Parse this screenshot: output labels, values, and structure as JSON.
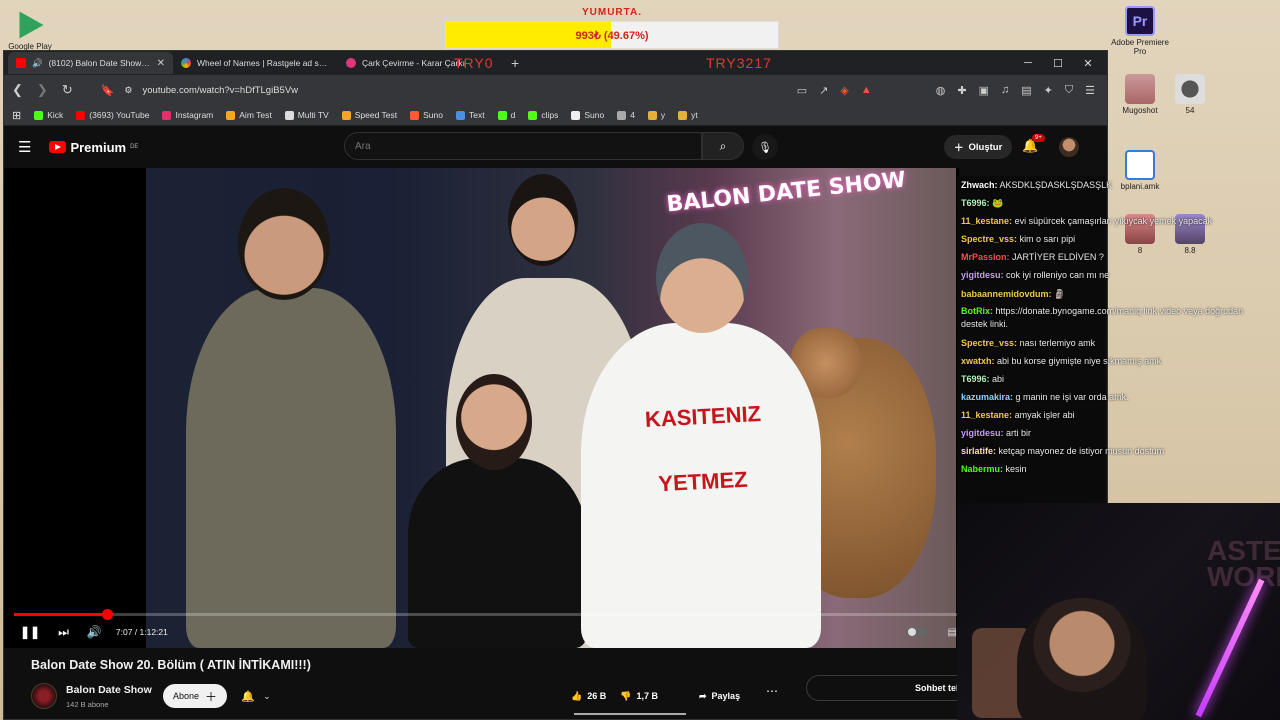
{
  "desktop": {
    "icons": [
      {
        "label": "Google Play",
        "color": "#2fa35d"
      },
      {
        "label": "Adobe Premiere Pro",
        "color": "#1d1144"
      },
      {
        "label": "Mugoshot",
        "color": "#c99"
      },
      {
        "label": "54",
        "color": "#888"
      },
      {
        "label": "bplani.amk",
        "color": "#3a7bd5"
      },
      {
        "label": "8",
        "color": "#c77"
      },
      {
        "label": "8.8",
        "color": "#86a"
      }
    ]
  },
  "donation": {
    "title": "YUMURTA.",
    "value": "993₺ (49.67%)",
    "progress_fraction": 0.4967
  },
  "browser": {
    "overlay_left": "TRY0",
    "overlay_right": "TRY3217",
    "tabs": [
      {
        "title": "(8102) Balon Date Show 20. B",
        "favicon_color": "#ff0000"
      },
      {
        "title": "Wheel of Names | Rastgele ad seçici",
        "favicon_color": "#4285f4"
      },
      {
        "title": "Çark Çevirme - Karar Çarkı",
        "favicon_color": "#e0367a"
      }
    ],
    "url": "youtube.com/watch?v=hDfTLgiB5Vw",
    "bookmarks": [
      {
        "label": "Kick",
        "color": "#53fc18"
      },
      {
        "label": "(3693) YouTube",
        "color": "#ff0000"
      },
      {
        "label": "Instagram",
        "color": "#e1306c"
      },
      {
        "label": "Aim Test",
        "color": "#f5a623"
      },
      {
        "label": "Multi TV",
        "color": "#ddd"
      },
      {
        "label": "Speed Test",
        "color": "#f5a623"
      },
      {
        "label": "Suno",
        "color": "#ff5b2e"
      },
      {
        "label": "Text",
        "color": "#4a90e2"
      },
      {
        "label": "d",
        "color": "#53fc18"
      },
      {
        "label": "clips",
        "color": "#53fc18"
      },
      {
        "label": "Suno",
        "color": "#eee"
      },
      {
        "label": "4",
        "color": "#aaa"
      },
      {
        "label": "y",
        "color": "#e5b13b"
      },
      {
        "label": "yt",
        "color": "#e5b13b"
      }
    ]
  },
  "youtube": {
    "logo": "Premium",
    "logo_region": "DE",
    "search_placeholder": "Ara",
    "create_label": "Oluştur",
    "notif_count": "9+",
    "player": {
      "current_time": "7:07",
      "duration": "1:12:21",
      "timecode": "7:07 / 1:12:21",
      "progress_fraction": 0.098,
      "shirt_text_1": "KASITENIZ",
      "shirt_text_2": "YETMEZ",
      "sign_text": "BALON DATE SHOW"
    },
    "video_title": "Balon Date Show 20. Bölüm ( ATIN İNTİKAMI!!!)",
    "channel_name": "Balon Date Show",
    "channel_subs": "142 B abone",
    "subscribe_label": "Abone",
    "likes": "26 B",
    "dislikes": "1,7 B",
    "share_label": "Paylaş",
    "chat_replay_label": "Sohbet tekrarını g"
  },
  "chat": {
    "messages": [
      {
        "user": "Zhwach:",
        "color": "#ffffff",
        "text": "AKSDKLŞDASKLŞDASŞLK"
      },
      {
        "user": "T6996:",
        "color": "#b4f0b4",
        "text": "🐸"
      },
      {
        "user": "11_kestane:",
        "color": "#f2c94c",
        "text": "evi süpürcek çamaşırları yıkıycak yemek yapacak"
      },
      {
        "user": "Spectre_vss:",
        "color": "#f2c94c",
        "text": "kim o sarı pipi"
      },
      {
        "user": "MrPassion:",
        "color": "#ff4d4d",
        "text": "JARTİYER ELDİVEN ?"
      },
      {
        "user": "yigitdesu:",
        "color": "#c59cff",
        "text": "cok iyi rolleniyo can mı ne"
      },
      {
        "user": "babaannemidovdum:",
        "color": "#f2c94c",
        "text": "🗿"
      },
      {
        "user": "BotRix:",
        "color": "#53fc18",
        "text": "https://donate.bynogame.com/maniq link.video veya doğrudan destek linki.",
        "wrap": true
      },
      {
        "user": "Spectre_vss:",
        "color": "#f2c94c",
        "text": "nası terlemiyo amk"
      },
      {
        "user": "xwatxh:",
        "color": "#f2c94c",
        "text": "abi bu korse giymişte niye sıkmamış amk"
      },
      {
        "user": "T6996:",
        "color": "#b4f0b4",
        "text": "abi"
      },
      {
        "user": "kazumakira:",
        "color": "#8fd3ff",
        "text": "g manin ne işi var orda amk."
      },
      {
        "user": "11_kestane:",
        "color": "#f2c94c",
        "text": "amyak işler abi"
      },
      {
        "user": "yigitdesu:",
        "color": "#c59cff",
        "text": "arti bir"
      },
      {
        "user": "sirlatife:",
        "color": "#ffe29a",
        "text": "ketçap mayonez de istiyor musun dostum"
      },
      {
        "user": "Nabermu:",
        "color": "#53fc18",
        "text": "kesin"
      }
    ]
  },
  "webcam": {
    "poster_text": "ASTE WORL"
  }
}
